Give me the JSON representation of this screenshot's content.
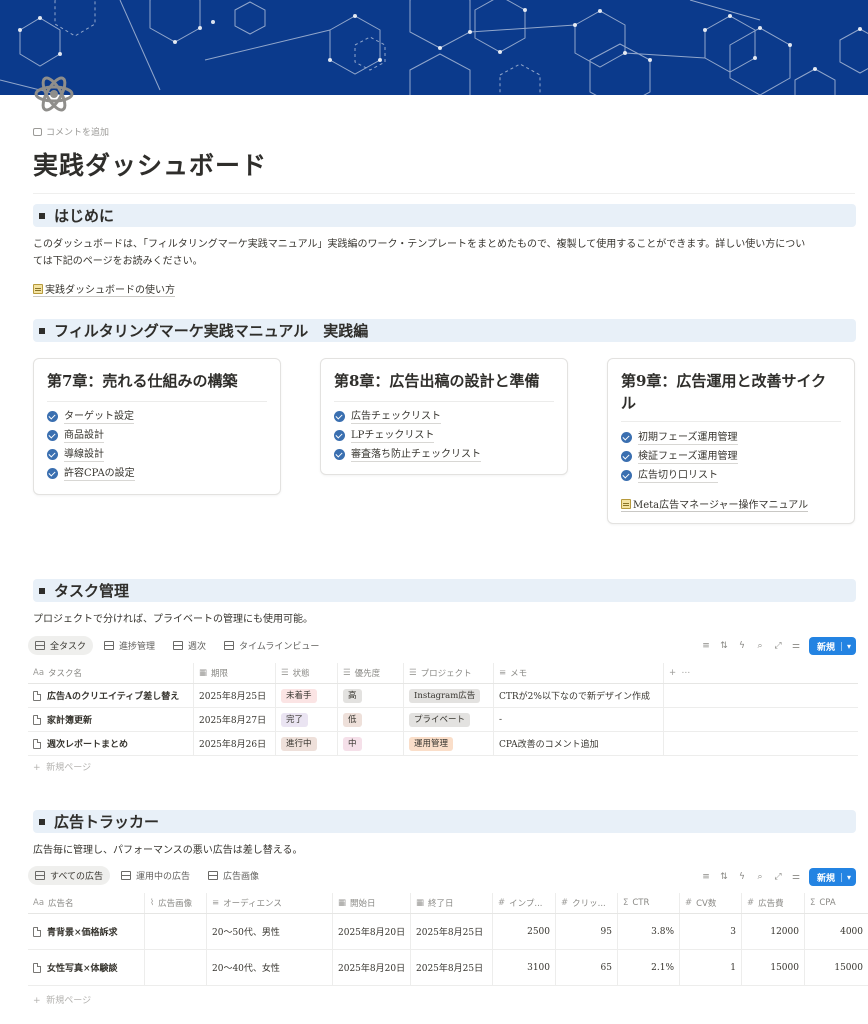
{
  "comment_label": "コメントを追加",
  "page_title": "実践ダッシュボード",
  "intro": {
    "heading": "はじめに",
    "text_line1": "このダッシュボードは、「フィルタリングマーケ実践マニュアル」実践編のワーク・テンプレートをまとめたもので、複製して使用することができます。詳しい使い方につい",
    "text_line2": "ては下記のページをお読みください。",
    "link": "実践ダッシュボードの使い方"
  },
  "manual": {
    "heading": "フィルタリングマーケ実践マニュアル　実践編",
    "cards": [
      {
        "title": "第7章：売れる仕組みの構築",
        "items": [
          "ターゲット設定",
          "商品設計",
          "導線設計",
          "許容CPAの設定"
        ]
      },
      {
        "title": "第8章：広告出稿の設計と準備",
        "items": [
          "広告チェックリスト",
          "LPチェックリスト",
          "審査落ち防止チェックリスト"
        ]
      },
      {
        "title_line1": "第9章：広告運用と改善サイク",
        "title_line2": "ル",
        "items": [
          "初期フェーズ運用管理",
          "検証フェーズ運用管理",
          "広告切り口リスト"
        ],
        "link": "Meta広告マネージャー操作マニュアル"
      }
    ]
  },
  "tasks": {
    "heading": "タスク管理",
    "description": "プロジェクトで分ければ、プライベートの管理にも使用可能。",
    "tabs": [
      "全タスク",
      "進捗管理",
      "週次",
      "タイムラインビュー"
    ],
    "new_label": "新規",
    "columns": [
      "タスク名",
      "期限",
      "状態",
      "優先度",
      "プロジェクト",
      "メモ"
    ],
    "rows": [
      {
        "name": "広告Aのクリエイティブ差し替え",
        "due": "2025年8月25日",
        "status": "未着手",
        "priority": "高",
        "project": "Instagram広告",
        "memo": "CTRが2%以下なので新デザイン作成"
      },
      {
        "name": "家計簿更新",
        "due": "2025年8月27日",
        "status": "完了",
        "priority": "低",
        "project": "プライベート",
        "memo": "-"
      },
      {
        "name": "週次レポートまとめ",
        "due": "2025年8月26日",
        "status": "進行中",
        "priority": "中",
        "project": "運用管理",
        "memo": "CPA改善のコメント追加"
      }
    ],
    "new_page": "新規ページ"
  },
  "ads": {
    "heading": "広告トラッカー",
    "description": "広告毎に管理し、パフォーマンスの悪い広告は差し替える。",
    "tabs": [
      "すべての広告",
      "運用中の広告",
      "広告画像"
    ],
    "new_label": "新規",
    "columns": [
      "広告名",
      "広告画像",
      "オーディエンス",
      "開始日",
      "終了日",
      "インプ...",
      "クリッ...",
      "CTR",
      "CV数",
      "広告費",
      "CPA"
    ],
    "rows": [
      {
        "name": "青背景×価格訴求",
        "image": "",
        "audience": "20〜50代、男性",
        "start": "2025年8月20日",
        "end": "2025年8月25日",
        "imp": "2500",
        "click": "95",
        "ctr": "3.8%",
        "cv": "3",
        "cost": "12000",
        "cpa": "4000"
      },
      {
        "name": "女性写真×体験談",
        "image": "",
        "audience": "20〜40代、女性",
        "start": "2025年8月20日",
        "end": "2025年8月25日",
        "imp": "3100",
        "click": "65",
        "ctr": "2.1%",
        "cv": "1",
        "cost": "15000",
        "cpa": "15000"
      }
    ],
    "new_page": "新規ページ"
  },
  "colors": {
    "cover": "#0b3a8c",
    "heading_bg": "#e8f0f8",
    "check": "#3a6fb0",
    "new_button": "#2383e2",
    "tag_red": "#fbe4e4",
    "tag_purple": "#eae4f2",
    "tag_gray": "#e3e2e0",
    "tag_brown": "#eee0da",
    "tag_orange": "#fadec9",
    "tag_pink": "#f5e0e9"
  },
  "icons": [
    "atom-icon",
    "comment-icon",
    "memo-icon",
    "check-circle-icon",
    "table-icon",
    "board-icon",
    "calendar-icon",
    "timeline-icon",
    "filter-icon",
    "sort-icon",
    "lightning-icon",
    "search-icon",
    "expand-icon",
    "settings-icon",
    "doc-icon",
    "gallery-icon"
  ]
}
